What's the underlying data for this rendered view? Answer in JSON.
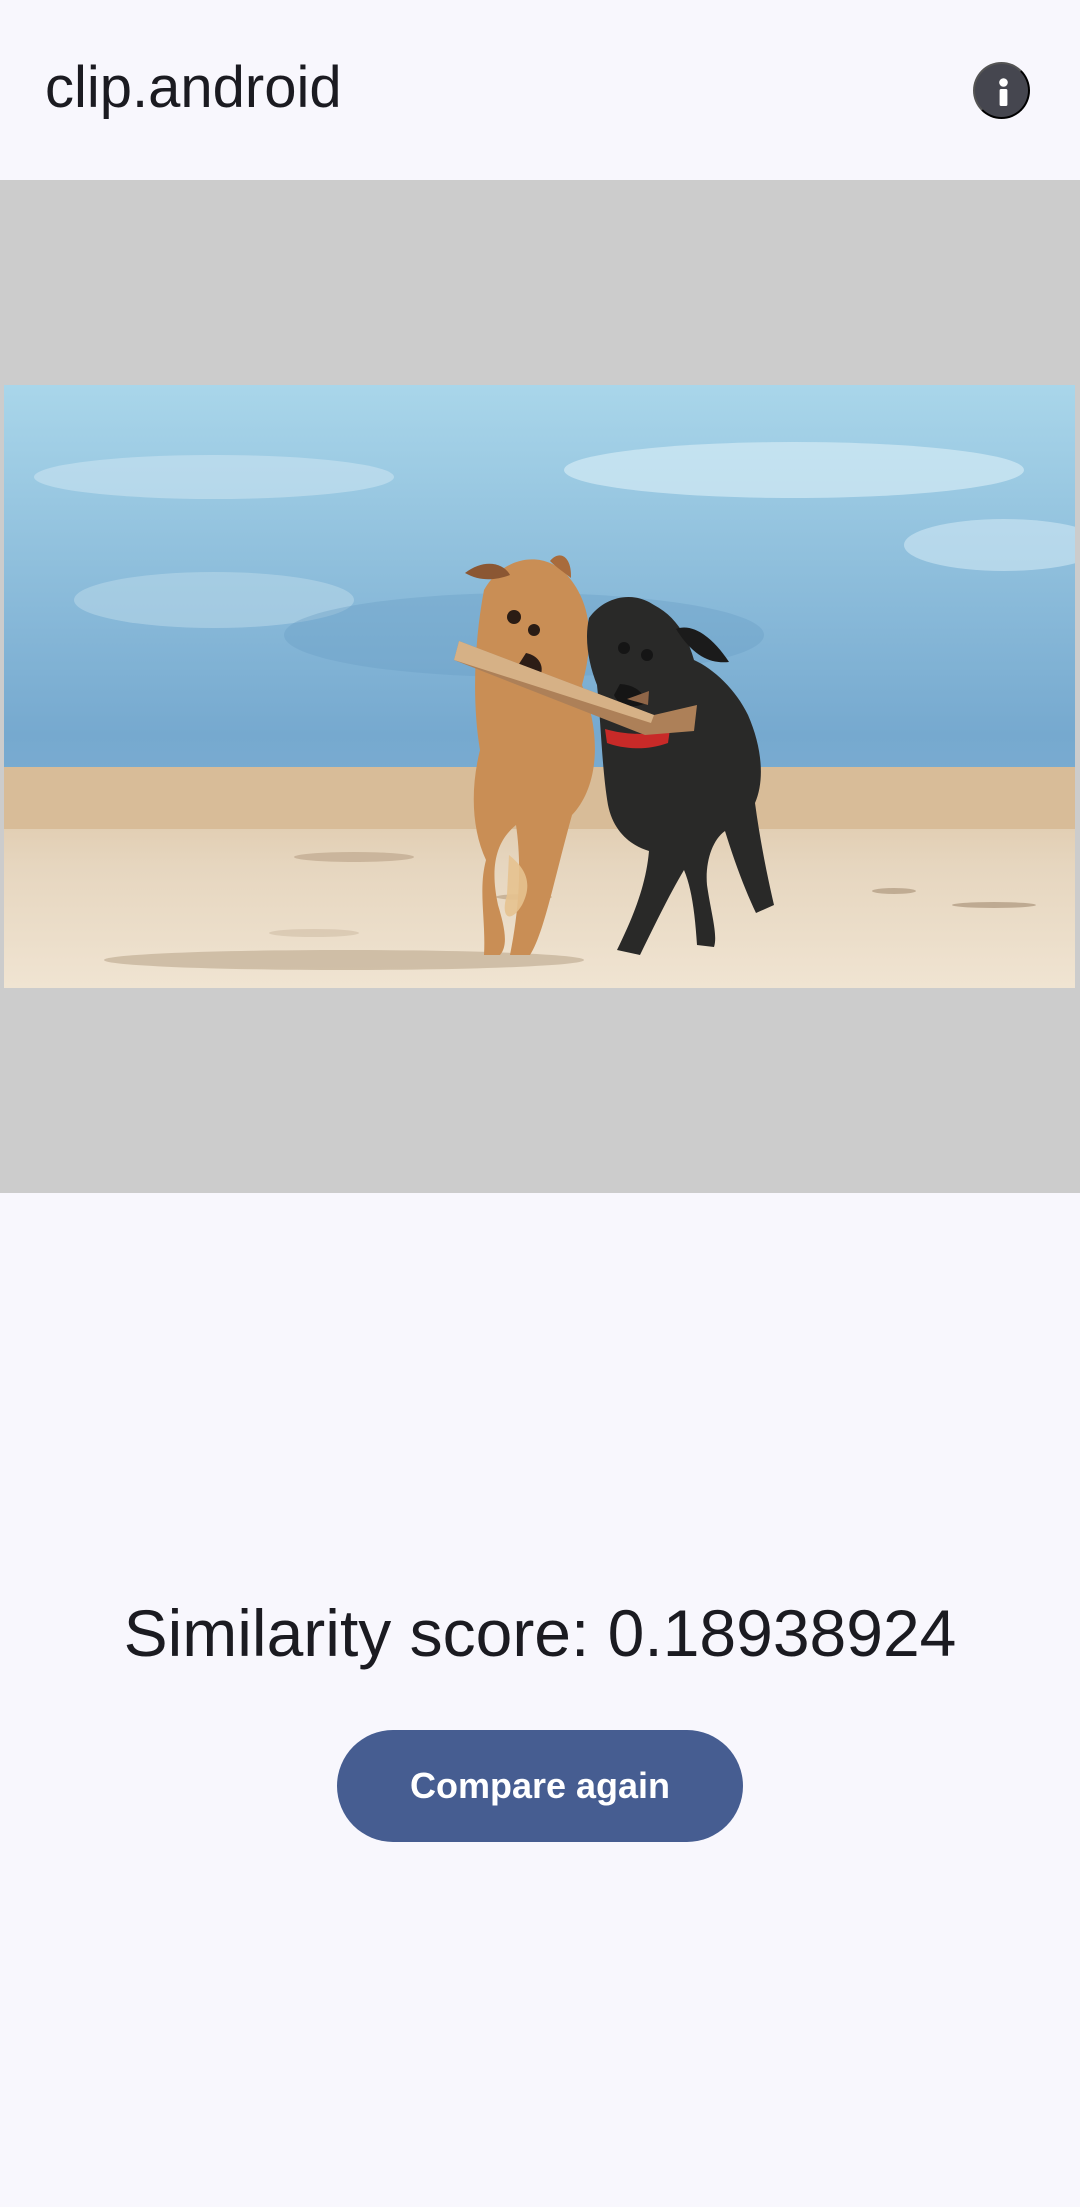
{
  "app_bar": {
    "title": "clip.android",
    "info_icon": "info-icon"
  },
  "image": {
    "subject_icon": "photo-dogs-on-beach"
  },
  "result": {
    "similarity_text": "Similarity score: 0.18938924"
  },
  "actions": {
    "compare_again_label": "Compare again"
  },
  "colors": {
    "background": "#f8f7fd",
    "image_background": "#cccccc",
    "primary_button": "#465d91",
    "icon_background": "#45464f",
    "text": "#1b1b21"
  }
}
